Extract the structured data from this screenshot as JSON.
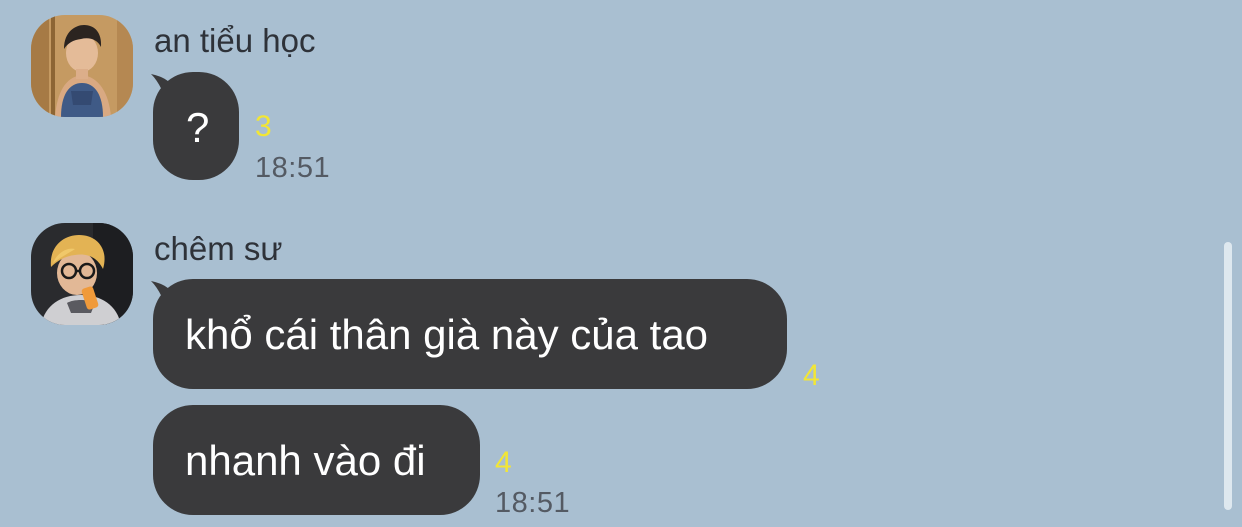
{
  "messages": [
    {
      "sender": "an tiểu học",
      "bubbles": [
        {
          "text": "?",
          "unread": "3"
        }
      ],
      "time": "18:51"
    },
    {
      "sender": "chêm sư",
      "bubbles": [
        {
          "text": "khổ cái thân già này của tao",
          "unread": "4"
        },
        {
          "text": "nhanh vào đi",
          "unread": "4"
        }
      ],
      "time": "18:51"
    }
  ],
  "colors": {
    "background": "#a9bfd1",
    "bubble": "#3a3a3c",
    "bubble_text": "#ffffff",
    "unread_count": "#f2e635",
    "timestamp": "#545a63"
  }
}
